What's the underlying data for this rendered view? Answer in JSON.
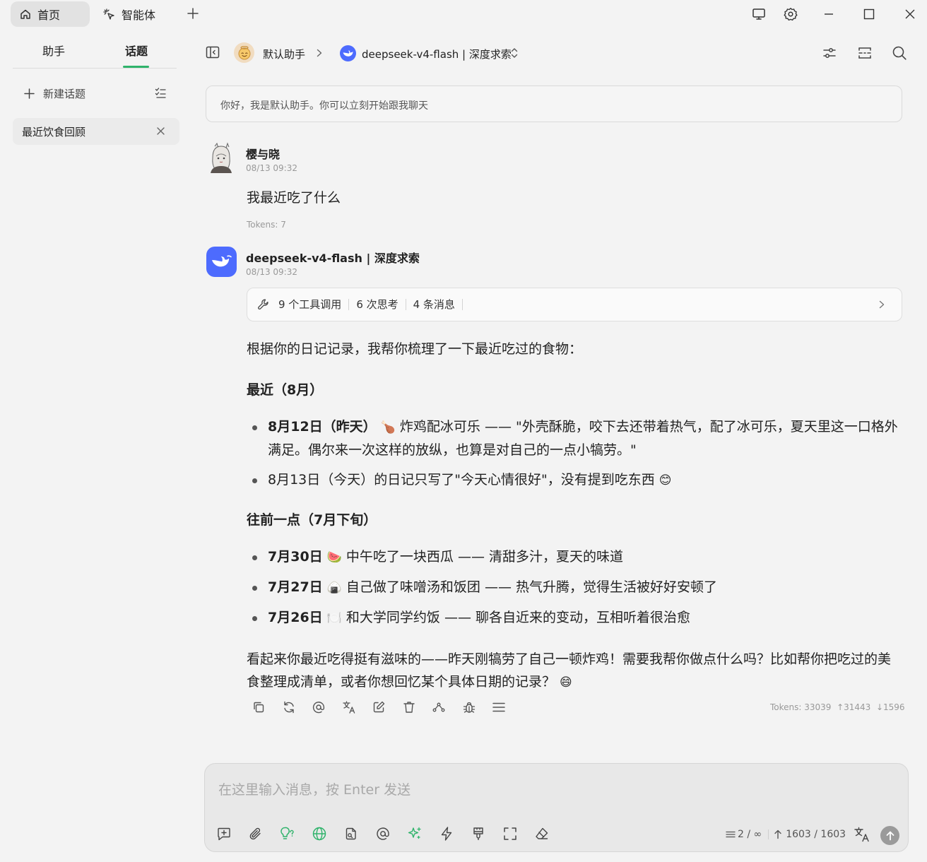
{
  "topbar": {
    "home_tab": "首页",
    "agents_tab": "智能体"
  },
  "sidebar": {
    "tab_assistant": "助手",
    "tab_topics": "话题",
    "new_topic": "新建话题",
    "topics": [
      {
        "title": "最近饮食回顾"
      }
    ]
  },
  "header": {
    "assistant_name": "默认助手",
    "model_name": "deepseek-v4-flash | 深度求索"
  },
  "welcome": "你好，我是默认助手。你可以立刻开始跟我聊天",
  "messages": {
    "user": {
      "name": "樱与晓",
      "time": "08/13 09:32",
      "text": "我最近吃了什么",
      "tokens": "Tokens: 7"
    },
    "assistant": {
      "name": "deepseek-v4-flash | 深度求索",
      "time": "08/13 09:32",
      "tool_calls": "9 个工具调用",
      "thinking": "6 次思考",
      "msgs": "4 条消息",
      "intro": "根据你的日记记录，我帮你梳理了一下最近吃过的食物：",
      "section1": "最近（8月）",
      "s1_item1_date": "8月12日（昨天）",
      "s1_item1_emoji": "🍗",
      "s1_item1_text": " 炸鸡配冰可乐 —— \"外壳酥脆，咬下去还带着热气，配了冰可乐，夏天里这一口格外满足。偶尔来一次这样的放纵，也算是对自己的一点小犒劳。\"",
      "s1_item2_text": "8月13日（今天）的日记只写了\"今天心情很好\"，没有提到吃东西 ",
      "s1_item2_emoji": "😊",
      "section2": "往前一点（7月下旬）",
      "s2_item1_date": "7月30日",
      "s2_item1_emoji": "🍉",
      "s2_item1_text": " 中午吃了一块西瓜 —— 清甜多汁，夏天的味道",
      "s2_item2_date": "7月27日",
      "s2_item2_emoji": "🍙",
      "s2_item2_text": " 自己做了味噌汤和饭团 —— 热气升腾，觉得生活被好好安顿了",
      "s2_item3_date": "7月26日",
      "s2_item3_emoji": "🍽️",
      "s2_item3_text": " 和大学同学约饭 —— 聊各自近来的变动，互相听着很治愈",
      "outro": "看起来你最近吃得挺有滋味的——昨天刚犒劳了自己一顿炸鸡！需要我帮你做点什么吗？比如帮你把吃过的美食整理成清单，或者你想回忆某个具体日期的记录？ ",
      "outro_emoji": "😄",
      "tokens": "Tokens: 33039",
      "tokens_up": "31443",
      "tokens_down": "1596"
    }
  },
  "input": {
    "placeholder": "在这里输入消息，按 Enter 发送",
    "context_count": "2 / ∞",
    "token_count": "1603 / 1603"
  },
  "colors": {
    "accent_green": "#2fb36b",
    "deepseek_blue": "#4d6bfe",
    "background": "#f3f3f3"
  }
}
